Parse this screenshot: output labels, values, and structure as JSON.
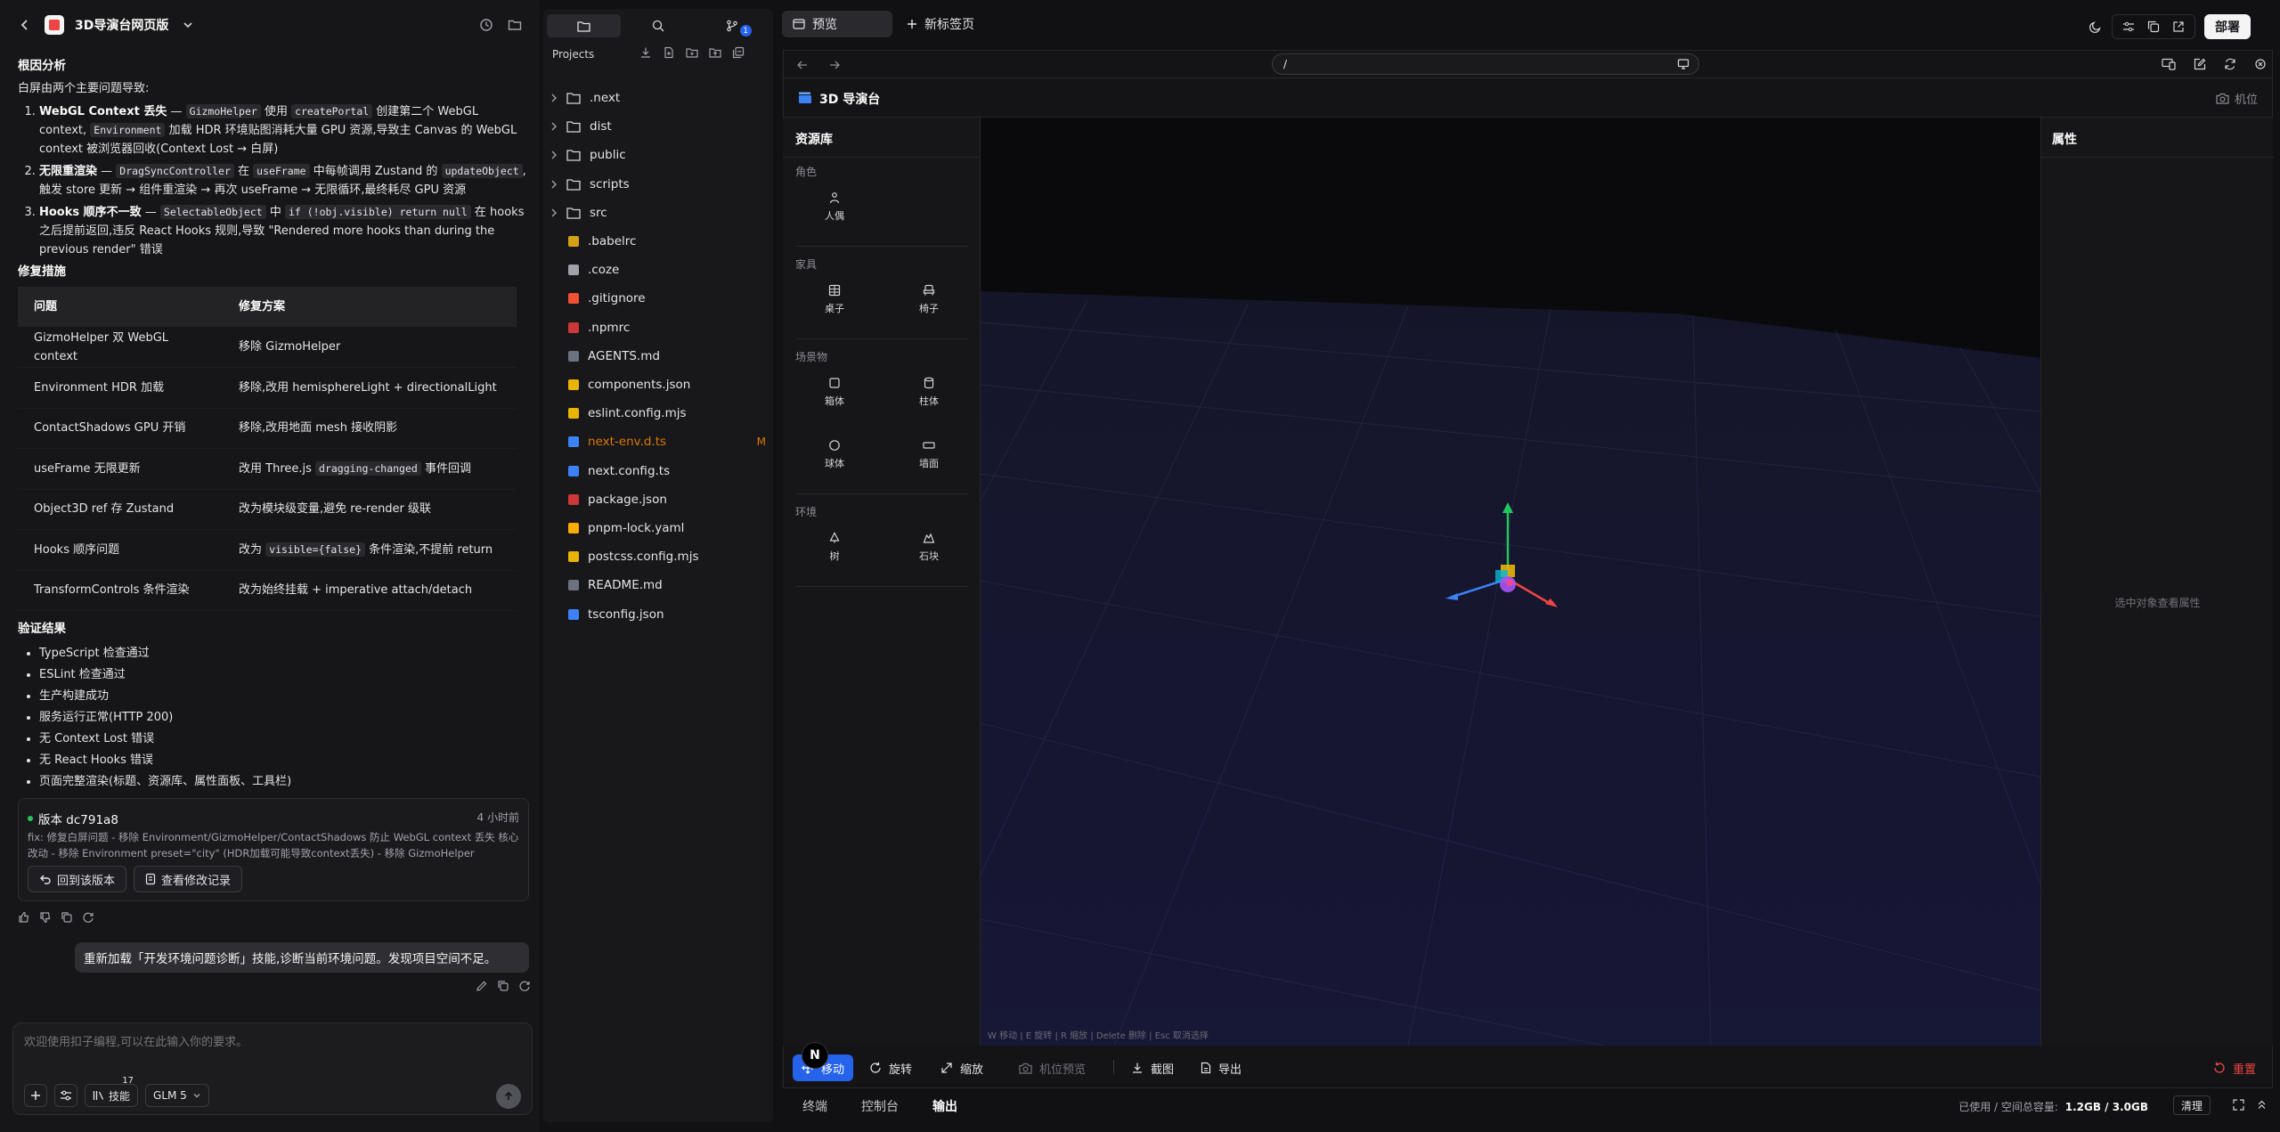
{
  "chat": {
    "title": "3D导演台网页版",
    "section_root": "根因分析",
    "intro": "白屏由两个主要问题导致:",
    "causes": [
      {
        "title": "WebGL Context 丢失",
        "pre": " — ",
        "c1": "GizmoHelper",
        "m1": " 使用 ",
        "c2": "createPortal",
        "m2": " 创建第二个 WebGL context, ",
        "c3": "Environment",
        "m3": " 加载 HDR 环境贴图消耗大量 GPU 资源,导致主 Canvas 的 WebGL context 被浏览器回收(Context Lost → 白屏)"
      },
      {
        "title": "无限重渲染",
        "pre": " — ",
        "c1": "DragSyncController",
        "m1": " 在 ",
        "c2": "useFrame",
        "m2": " 中每帧调用 Zustand 的 ",
        "c3": "updateObject",
        "m3": ",触发 store 更新 → 组件重渲染 → 再次 useFrame → 无限循环,最终耗尽 GPU 资源"
      },
      {
        "title": "Hooks 顺序不一致",
        "pre": " — ",
        "c1": "SelectableObject",
        "m1": " 中 ",
        "c2": "if (!obj.visible) return null",
        "m2": " 在 hooks 之后提前返回,违反 React Hooks 规则,导致 \"Rendered more hooks than during the previous render\" 错误",
        "c3": "",
        "m3": ""
      }
    ],
    "section_fix": "修复措施",
    "fix_headers": [
      "问题",
      "修复方案"
    ],
    "fix_rows": [
      {
        "problem": "GizmoHelper 双 WebGL context",
        "solution": "移除 GizmoHelper",
        "code": "",
        "after": ""
      },
      {
        "problem": "Environment HDR 加载",
        "solution": "移除,改用 hemisphereLight + directionalLight",
        "code": "",
        "after": ""
      },
      {
        "problem": "ContactShadows GPU 开销",
        "solution": "移除,改用地面 mesh 接收阴影",
        "code": "",
        "after": ""
      },
      {
        "problem": "useFrame 无限更新",
        "solution": "改用 Three.js ",
        "code": "dragging-changed",
        "after": " 事件回调"
      },
      {
        "problem": "Object3D ref 存 Zustand",
        "solution": "改为模块级变量,避免 re-render 级联",
        "code": "",
        "after": ""
      },
      {
        "problem": "Hooks 顺序问题",
        "solution": "改为 ",
        "code": "visible={false}",
        "after": " 条件渲染,不提前 return"
      },
      {
        "problem": "TransformControls 条件渲染",
        "solution": "改为始终挂载 + imperative attach/detach",
        "code": "",
        "after": ""
      }
    ],
    "section_verify": "验证结果",
    "verify_items": [
      "TypeScript 检查通过",
      "ESLint 检查通过",
      "生产构建成功",
      "服务运行正常(HTTP 200)",
      "无 Context Lost 错误",
      "无 React Hooks 错误",
      "页面完整渲染(标题、资源库、属性面板、工具栏)"
    ],
    "version": {
      "label": "版本 dc791a8",
      "time": "4 小时前",
      "desc": "fix: 修复白屏问题 - 移除 Environment/GizmoHelper/ContactShadows 防止 WebGL context 丢失 核心改动 - 移除 Environment preset=\"city\" (HDR加载可能导致context丢失) - 移除 GizmoHelper (createPortal...",
      "restore_label": "回到该版本",
      "history_label": "查看修改记录"
    },
    "user_message": "重新加载「开发环境问题诊断」技能,诊断当前环境问题。发现项目空间不足。",
    "input_placeholder": "欢迎使用扣子编程,可以在此输入你的要求。",
    "skills_label": "技能",
    "skills_count": "17",
    "model_label": "GLM 5"
  },
  "files": {
    "projects_label": "Projects",
    "git_badge": "1",
    "items": [
      {
        "name": ".next",
        "type": "folder",
        "icon_color": "",
        "badge": ""
      },
      {
        "name": "dist",
        "type": "folder",
        "icon_color": "",
        "badge": ""
      },
      {
        "name": "public",
        "type": "folder",
        "icon_color": "",
        "badge": ""
      },
      {
        "name": "scripts",
        "type": "folder",
        "icon_color": "",
        "badge": ""
      },
      {
        "name": "src",
        "type": "folder",
        "icon_color": "",
        "badge": ""
      },
      {
        "name": ".babelrc",
        "type": "file",
        "icon_color": "#d4a017",
        "badge": ""
      },
      {
        "name": ".coze",
        "type": "file",
        "icon_color": "#a1a1aa",
        "badge": ""
      },
      {
        "name": ".gitignore",
        "type": "file",
        "icon_color": "#f05133",
        "badge": ""
      },
      {
        "name": ".npmrc",
        "type": "file",
        "icon_color": "#cb3837",
        "badge": ""
      },
      {
        "name": "AGENTS.md",
        "type": "file",
        "icon_color": "#6b7280",
        "badge": ""
      },
      {
        "name": "components.json",
        "type": "file",
        "icon_color": "#eab308",
        "badge": ""
      },
      {
        "name": "eslint.config.mjs",
        "type": "file",
        "icon_color": "#eab308",
        "badge": ""
      },
      {
        "name": "next-env.d.ts",
        "type": "file",
        "icon_color": "#3b82f6",
        "badge": "M"
      },
      {
        "name": "next.config.ts",
        "type": "file",
        "icon_color": "#3b82f6",
        "badge": ""
      },
      {
        "name": "package.json",
        "type": "file",
        "icon_color": "#cb3837",
        "badge": ""
      },
      {
        "name": "pnpm-lock.yaml",
        "type": "file",
        "icon_color": "#f9ad00",
        "badge": ""
      },
      {
        "name": "postcss.config.mjs",
        "type": "file",
        "icon_color": "#eab308",
        "badge": ""
      },
      {
        "name": "README.md",
        "type": "file",
        "icon_color": "#6b7280",
        "badge": ""
      },
      {
        "name": "tsconfig.json",
        "type": "file",
        "icon_color": "#3b82f6",
        "badge": ""
      }
    ]
  },
  "preview": {
    "tab_preview": "预览",
    "tab_new": "新标签页",
    "deploy_label": "部署",
    "url": "/",
    "app_title": "3D 导演台",
    "camera_label": "机位",
    "assets_title": "资源库",
    "asset_sections": [
      {
        "name": "角色",
        "items": [
          {
            "label": "人偶",
            "icon": "person-icon"
          }
        ]
      },
      {
        "name": "家具",
        "items": [
          {
            "label": "桌子",
            "icon": "table-icon"
          },
          {
            "label": "椅子",
            "icon": "chair-icon"
          }
        ]
      },
      {
        "name": "场景物",
        "items": [
          {
            "label": "箱体",
            "icon": "box-icon"
          },
          {
            "label": "柱体",
            "icon": "cylinder-icon"
          },
          {
            "label": "球体",
            "icon": "sphere-icon"
          },
          {
            "label": "墙面",
            "icon": "wall-icon"
          }
        ]
      },
      {
        "name": "环境",
        "items": [
          {
            "label": "树",
            "icon": "tree-icon"
          },
          {
            "label": "石块",
            "icon": "rock-icon"
          }
        ]
      }
    ],
    "props_title": "属性",
    "props_empty": "选中对象查看属性",
    "hint": "W 移动 | E 旋转 | R 缩放 | Delete 删除 | Esc 取消选择",
    "tools": {
      "move": "移动",
      "rotate": "旋转",
      "scale": "缩放",
      "camera_preview": "机位预览",
      "screenshot": "截图",
      "export": "导出",
      "reset": "重置"
    },
    "bottom_tabs": [
      "终端",
      "控制台",
      "输出"
    ],
    "storage_label": "已使用 / 空间总容量:",
    "storage_value": "1.2GB / 3.0GB",
    "clean_label": "清理"
  },
  "colors": {
    "accent": "#2563eb",
    "reset": "#ef4444",
    "modified": "#d97706",
    "gizmo_x": "#ef4444",
    "gizmo_y": "#22c55e",
    "gizmo_z": "#3b82f6"
  }
}
